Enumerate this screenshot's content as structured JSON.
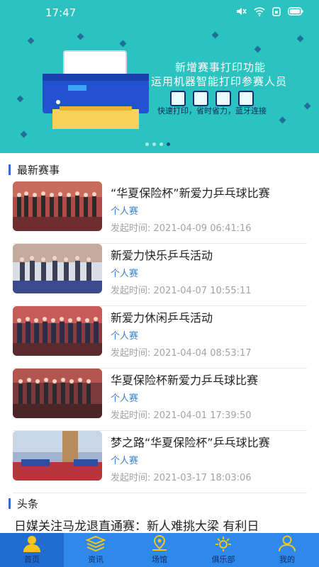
{
  "status": {
    "time": "17:47"
  },
  "banner": {
    "title_line1": "新增赛事打印功能",
    "title_line2": "运用机器智能打印参赛人员",
    "subtitle": "快速打印，省时省力，蓝牙连接"
  },
  "latest": {
    "section_title": "最新赛事",
    "events": [
      {
        "title": "“华夏保险杯”新爱力乒乓球比赛",
        "type": "个人赛",
        "time": "发起时间: 2021-04-09 06:41:16"
      },
      {
        "title": "新爱力快乐乒乓活动",
        "type": "个人赛",
        "time": "发起时间: 2021-04-07 10:55:11"
      },
      {
        "title": "新爱力休闲乒乓活动",
        "type": "个人赛",
        "time": "发起时间: 2021-04-04 08:53:17"
      },
      {
        "title": "华夏保险杯新爱力乒乓球比赛",
        "type": "个人赛",
        "time": "发起时间: 2021-04-01 17:39:50"
      },
      {
        "title": "梦之路“华夏保险杯”乒乓球比赛",
        "type": "个人赛",
        "time": "发起时间: 2021-03-17 18:03:06"
      }
    ]
  },
  "headlines": {
    "section_title": "头条",
    "first": "日媒关注马龙退直通赛：新人难挑大梁 有利日"
  },
  "tabbar": {
    "items": [
      {
        "label": "首页",
        "icon": "home-icon"
      },
      {
        "label": "资讯",
        "icon": "news-icon"
      },
      {
        "label": "场馆",
        "icon": "venue-icon"
      },
      {
        "label": "俱乐部",
        "icon": "club-icon"
      },
      {
        "label": "我的",
        "icon": "profile-icon"
      }
    ]
  },
  "colors": {
    "accent": "#2bc3c0",
    "tabbar": "#2f89ea",
    "link": "#3b82d1"
  }
}
